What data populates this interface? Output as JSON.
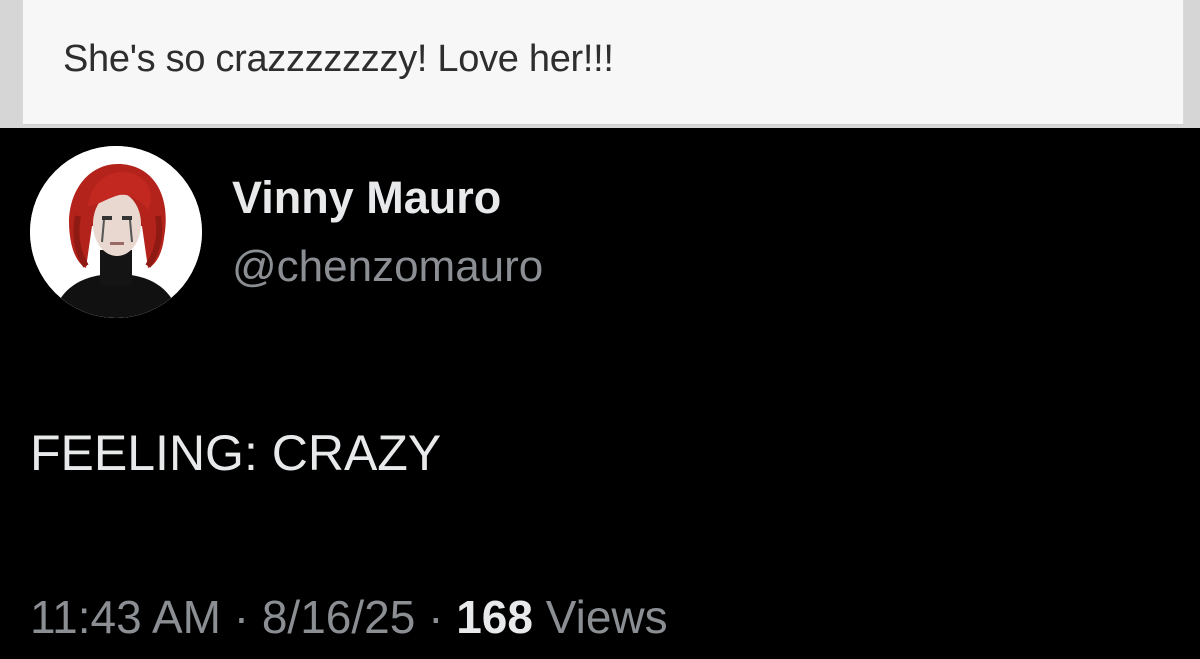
{
  "quoted_comment": {
    "text": "She's so crazzzzzzzy! Love her!!!"
  },
  "tweet": {
    "author": {
      "display_name": "Vinny Mauro",
      "handle": "@chenzomauro",
      "avatar_icon": "profile-photo"
    },
    "text": "FEELING: CRAZY",
    "time": "11:43 AM",
    "separator": "·",
    "date": "8/16/25",
    "views_count": "168",
    "views_label": "Views"
  },
  "colors": {
    "background": "#000000",
    "primary_text": "#e7e9ea",
    "secondary_text": "#8b8f94",
    "comment_background": "#f7f7f7",
    "comment_text": "#2e2e2e"
  }
}
